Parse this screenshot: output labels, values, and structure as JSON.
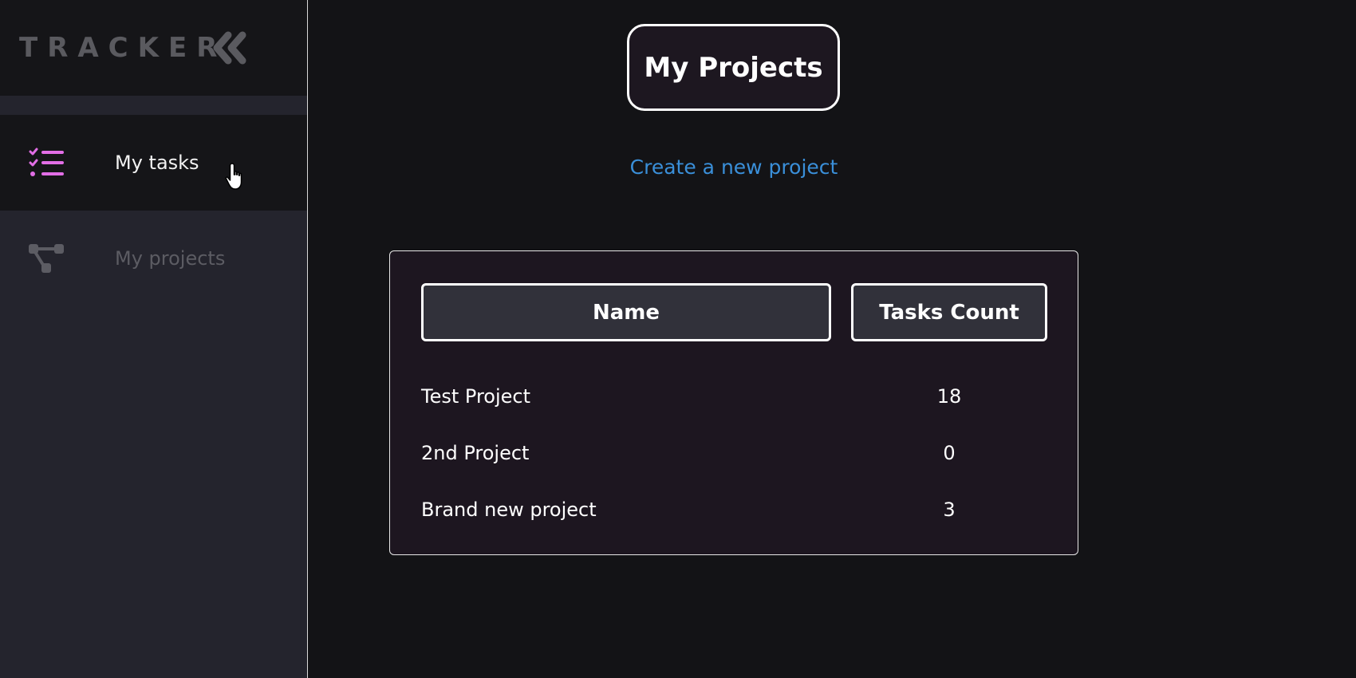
{
  "sidebar": {
    "brand": "TRACKER",
    "collapse_icon": "double-chevron-left-icon",
    "items": [
      {
        "label": "My tasks",
        "icon": "task-list-icon",
        "icon_color": "#e26ee6",
        "active": true
      },
      {
        "label": "My projects",
        "icon": "project-tree-icon",
        "icon_color": "#5c5c63",
        "active": false
      }
    ]
  },
  "main": {
    "title": "My Projects",
    "create_link": "Create a new project",
    "table": {
      "columns": [
        "Name",
        "Tasks Count"
      ],
      "rows": [
        {
          "name": "Test Project",
          "count": "18"
        },
        {
          "name": "2nd Project",
          "count": "0"
        },
        {
          "name": "Brand new project",
          "count": "3"
        }
      ]
    }
  },
  "colors": {
    "background": "#131316",
    "sidebar": "#24242d",
    "accent_link": "#3a8fd9",
    "accent_icon": "#e26ee6"
  }
}
